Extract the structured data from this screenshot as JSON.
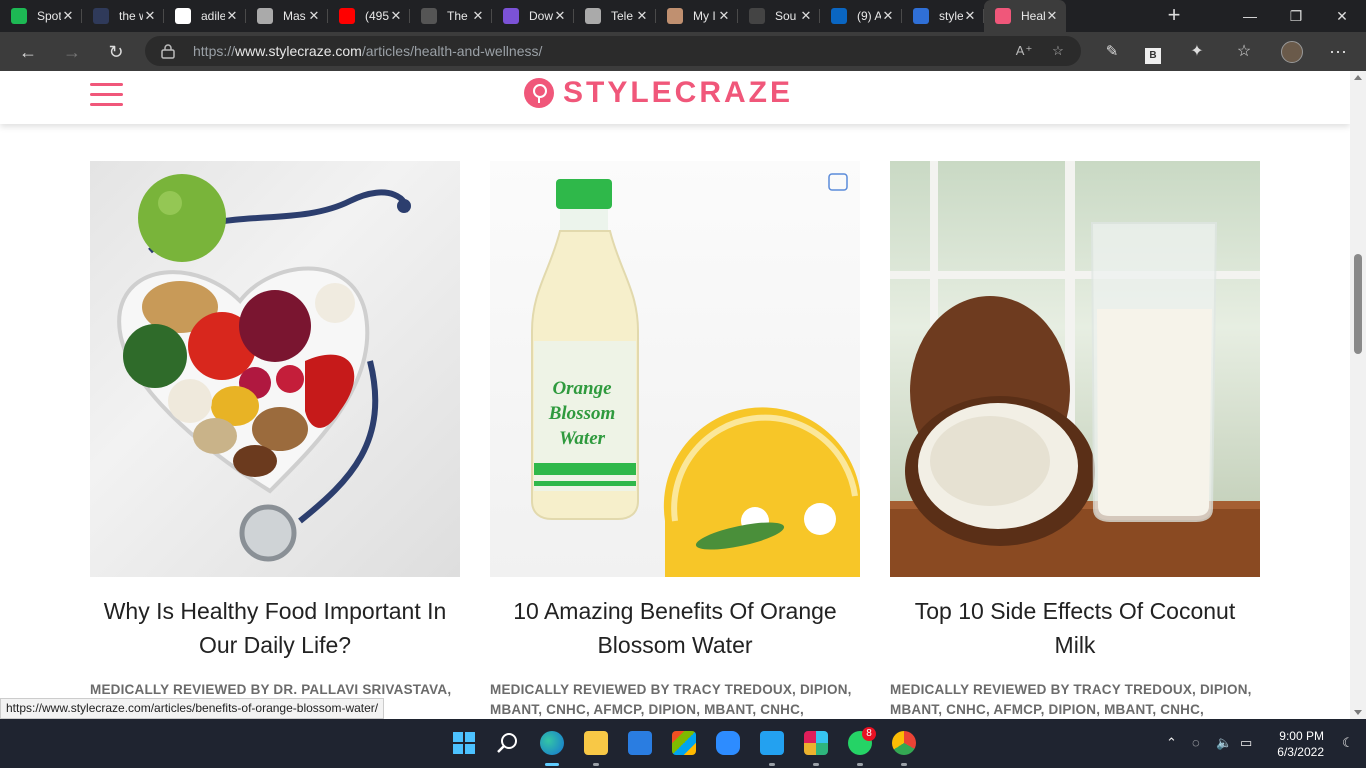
{
  "browser": {
    "tabs": [
      {
        "label": "Spotify",
        "icon": "spotify-icon",
        "color": "#1db954"
      },
      {
        "label": "the w",
        "icon": "page-icon",
        "color": "#2f3a5a"
      },
      {
        "label": "adile",
        "icon": "github-icon",
        "color": "#ffffff"
      },
      {
        "label": "Mas",
        "icon": "document-icon",
        "color": "#aaaaaa"
      },
      {
        "label": "(495",
        "icon": "youtube-icon",
        "color": "#ff0000"
      },
      {
        "label": "The",
        "icon": "google-icon",
        "color": "#555555"
      },
      {
        "label": "Dow",
        "icon": "gmail-icon",
        "color": "#7b52d6"
      },
      {
        "label": "Tele",
        "icon": "document-icon",
        "color": "#aaaaaa"
      },
      {
        "label": "My I",
        "icon": "profile-icon",
        "color": "#c09070"
      },
      {
        "label": "Sou",
        "icon": "profile-icon",
        "color": "#444444"
      },
      {
        "label": "(9) A",
        "icon": "linkedin-icon",
        "color": "#0a66c2"
      },
      {
        "label": "style",
        "icon": "search-icon",
        "color": "#2f6fd6"
      },
      {
        "label": "Heal",
        "icon": "stylecraze-icon",
        "color": "#f0577a",
        "active": true
      }
    ],
    "url_scheme": "https://",
    "url_host": "www.stylecraze.com",
    "url_path": "/articles/health-and-wellness/",
    "profile_badge": "B"
  },
  "site": {
    "logo_text": "STYLECRAZE",
    "brand_color": "#f0577a"
  },
  "articles": [
    {
      "title": "Why Is Healthy Food Important In Our Daily Life?",
      "meta": "MEDICALLY REVIEWED BY DR. PALLAVI SRIVASTAVA, MBBS"
    },
    {
      "title": "10 Amazing Benefits Of Orange Blossom Water",
      "meta": "MEDICALLY REVIEWED BY TRACY TREDOUX, DIPION, MBANT, CNHC, AFMCP, DIPION, MBANT, CNHC,",
      "bottle_label": [
        "Orange",
        "Blossom",
        "Water"
      ]
    },
    {
      "title": "Top 10 Side Effects Of Coconut Milk",
      "meta": "MEDICALLY REVIEWED BY TRACY TREDOUX, DIPION, MBANT, CNHC, AFMCP, DIPION, MBANT, CNHC,"
    }
  ],
  "status_url": "https://www.stylecraze.com/articles/benefits-of-orange-blossom-water/",
  "taskbar": {
    "whatsapp_badge": "8",
    "time": "9:00 PM",
    "date": "6/3/2022"
  }
}
